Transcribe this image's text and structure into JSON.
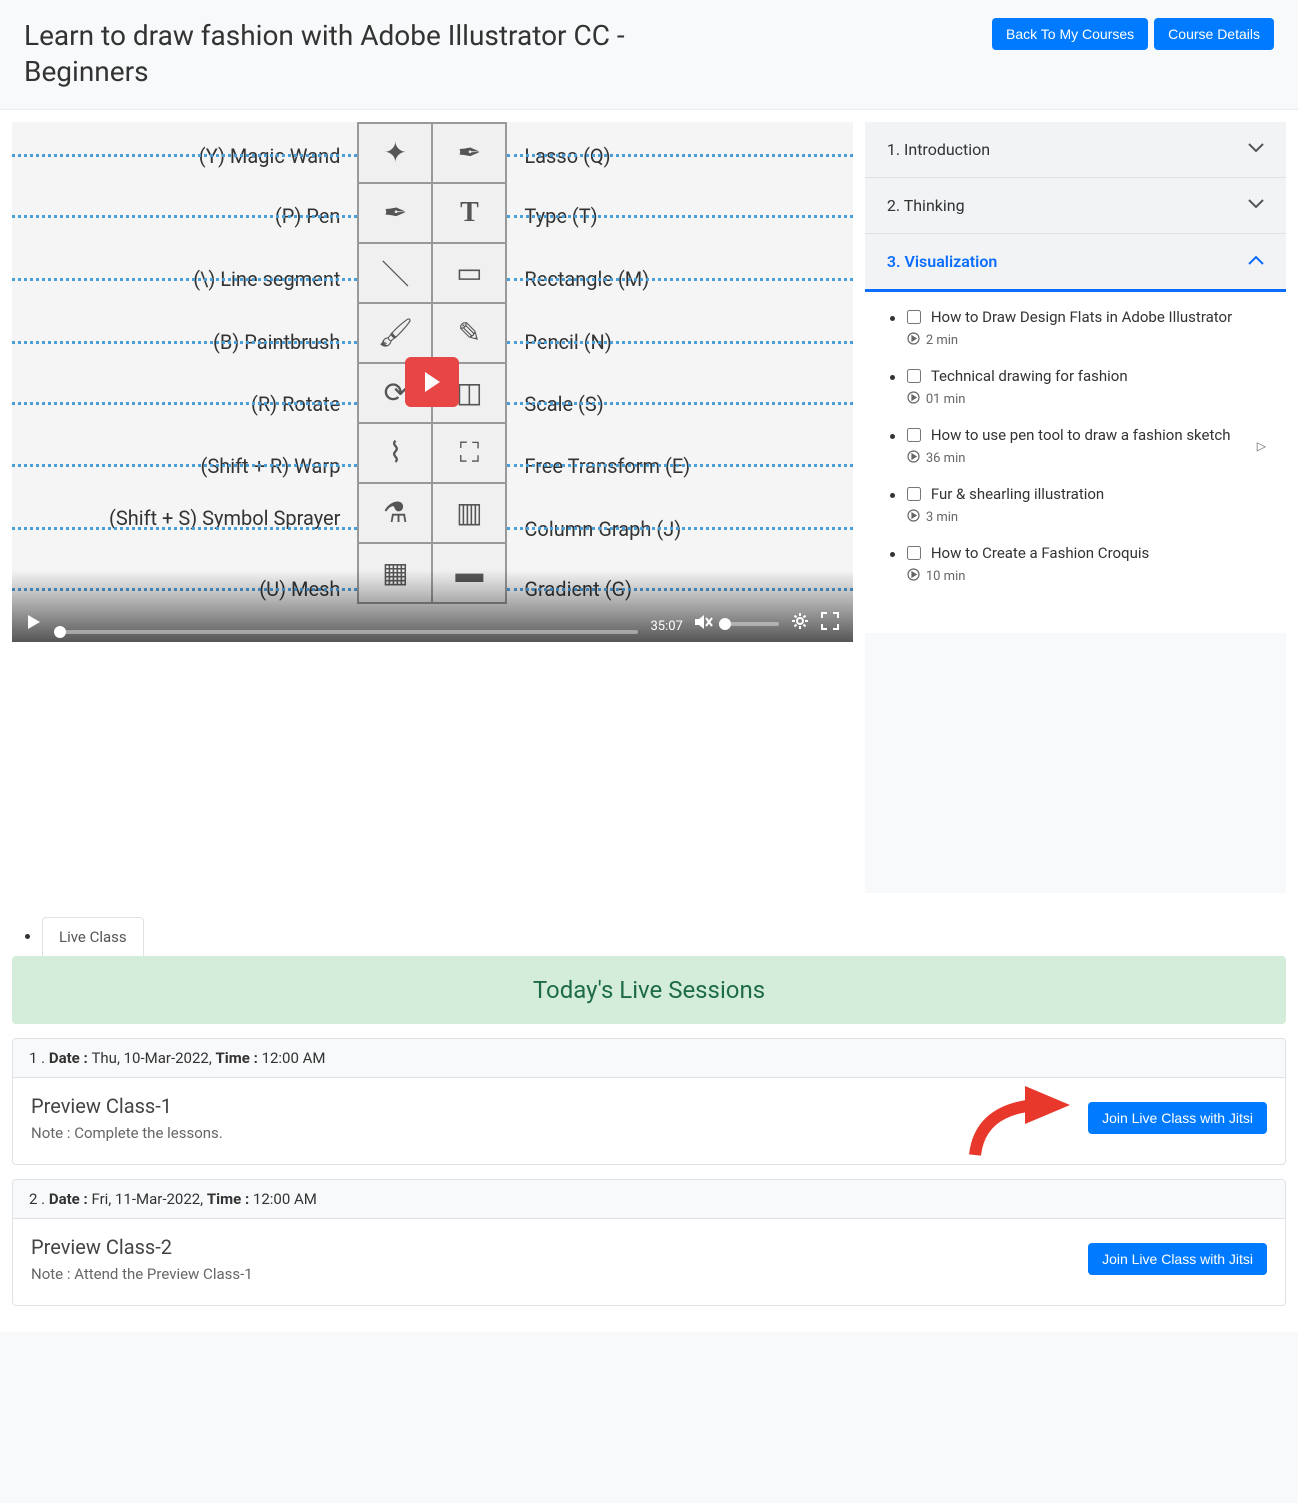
{
  "header": {
    "title": "Learn to draw fashion with Adobe Illustrator CC - Beginners",
    "back_btn": "Back To My Courses",
    "details_btn": "Course Details"
  },
  "video": {
    "time": "35:07",
    "tool_labels_left": [
      "(Y) Magic Wand",
      "(P) Pen",
      "(\\) Line segment",
      "(B) Paintbrush",
      "(R) Rotate",
      "(Shift + R) Warp",
      "(Shift + S) Symbol Sprayer",
      "(U) Mesh"
    ],
    "tool_labels_right": [
      "Lasso (Q)",
      "Type (T)",
      "Rectangle (M)",
      "Pencil (N)",
      "Scale (S)",
      "Free Transform (E)",
      "Column Graph (J)",
      "Gradient (G)"
    ]
  },
  "sections": [
    {
      "label": "1. Introduction"
    },
    {
      "label": "2. Thinking"
    },
    {
      "label": "3. Visualization"
    }
  ],
  "lessons": [
    {
      "title": "How to Draw Design Flats in Adobe Illustrator",
      "duration": "2 min"
    },
    {
      "title": "Technical drawing for fashion",
      "duration": "01 min"
    },
    {
      "title": "How to use pen tool to draw a fashion sketch",
      "duration": "36 min",
      "current": true
    },
    {
      "title": "Fur & shearling illustration",
      "duration": "3 min"
    },
    {
      "title": "How to Create a Fashion Croquis",
      "duration": "10 min"
    }
  ],
  "tabs": {
    "live": "Live Class"
  },
  "sessions_banner": "Today's Live Sessions",
  "sessions": [
    {
      "index": "1 . ",
      "date_label": "Date : ",
      "date": "Thu, 10-Mar-2022, ",
      "time_label": "Time : ",
      "time": "12:00 AM",
      "title": "Preview Class-1",
      "note": "Note : Complete the lessons.",
      "join_btn": "Join Live Class with Jitsi",
      "has_arrow": true
    },
    {
      "index": "2 . ",
      "date_label": "Date : ",
      "date": "Fri, 11-Mar-2022, ",
      "time_label": "Time : ",
      "time": "12:00 AM",
      "title": "Preview Class-2",
      "note": "Note : Attend the Preview Class-1",
      "join_btn": "Join Live Class with Jitsi",
      "has_arrow": false
    }
  ]
}
